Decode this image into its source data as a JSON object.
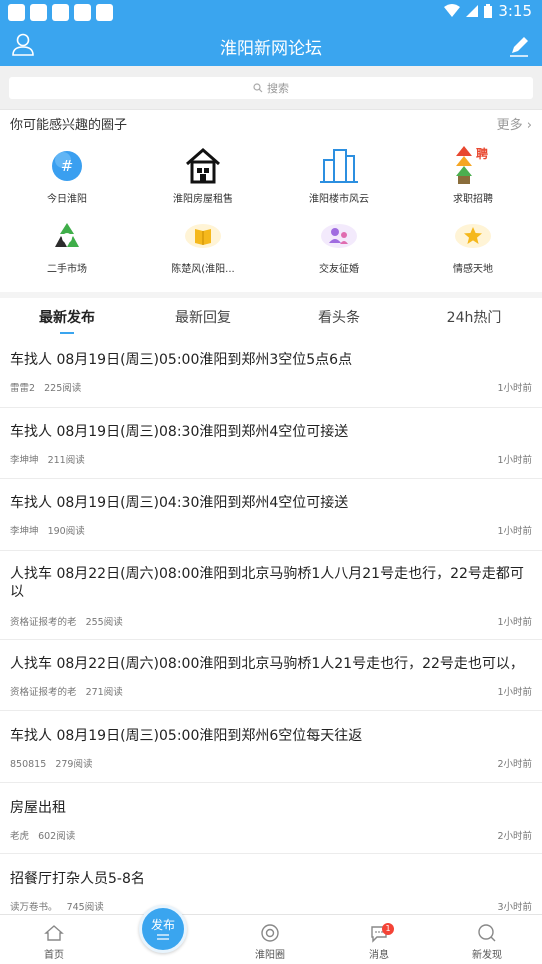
{
  "status_bar": {
    "time": "3:15"
  },
  "app_bar": {
    "title": "淮阳新网论坛"
  },
  "search": {
    "placeholder": "搜索"
  },
  "circles": {
    "heading": "你可能感兴趣的圈子",
    "more": "更多",
    "items": [
      {
        "label": "今日淮阳",
        "icon": "hashtag-icon"
      },
      {
        "label": "淮阳房屋租售",
        "icon": "house-icon"
      },
      {
        "label": "淮阳楼市风云",
        "icon": "buildings-icon"
      },
      {
        "label": "求职招聘",
        "icon": "recruit-icon"
      },
      {
        "label": "二手市场",
        "icon": "recycle-icon"
      },
      {
        "label": "陈楚风(淮阳...",
        "icon": "book-icon"
      },
      {
        "label": "交友征婚",
        "icon": "people-icon"
      },
      {
        "label": "情感天地",
        "icon": "star-icon"
      }
    ]
  },
  "tabs": [
    "最新发布",
    "最新回复",
    "看头条",
    "24h热门"
  ],
  "posts": [
    {
      "title": "车找人  08月19日(周三)05:00淮阳到郑州3空位5点6点",
      "author": "雷雷2",
      "reads": "225阅读",
      "time": "1小时前"
    },
    {
      "title": "车找人  08月19日(周三)08:30淮阳到郑州4空位可接送",
      "author": "李坤坤",
      "reads": "211阅读",
      "time": "1小时前"
    },
    {
      "title": "车找人  08月19日(周三)04:30淮阳到郑州4空位可接送",
      "author": "李坤坤",
      "reads": "190阅读",
      "time": "1小时前"
    },
    {
      "title": "人找车  08月22日(周六)08:00淮阳到北京马驹桥1人八月21号走也行，22号走都可以",
      "author": "资格证报考的老",
      "reads": "255阅读",
      "time": "1小时前"
    },
    {
      "title": "人找车  08月22日(周六)08:00淮阳到北京马驹桥1人21号走也行，22号走也可以，",
      "author": "资格证报考的老",
      "reads": "271阅读",
      "time": "1小时前"
    },
    {
      "title": "车找人  08月19日(周三)05:00淮阳到郑州6空位每天往返",
      "author": "850815",
      "reads": "279阅读",
      "time": "2小时前"
    },
    {
      "title": "房屋出租",
      "author": "老虎",
      "reads": "602阅读",
      "time": "2小时前"
    },
    {
      "title": "招餐厅打杂人员5-8名",
      "author": "读万卷书。",
      "reads": "745阅读",
      "time": "3小时前"
    }
  ],
  "bottom_nav": {
    "home": "首页",
    "publish": "发布",
    "circle": "淮阳圈",
    "messages": "消息",
    "message_badge": "1",
    "discover": "新发现"
  }
}
